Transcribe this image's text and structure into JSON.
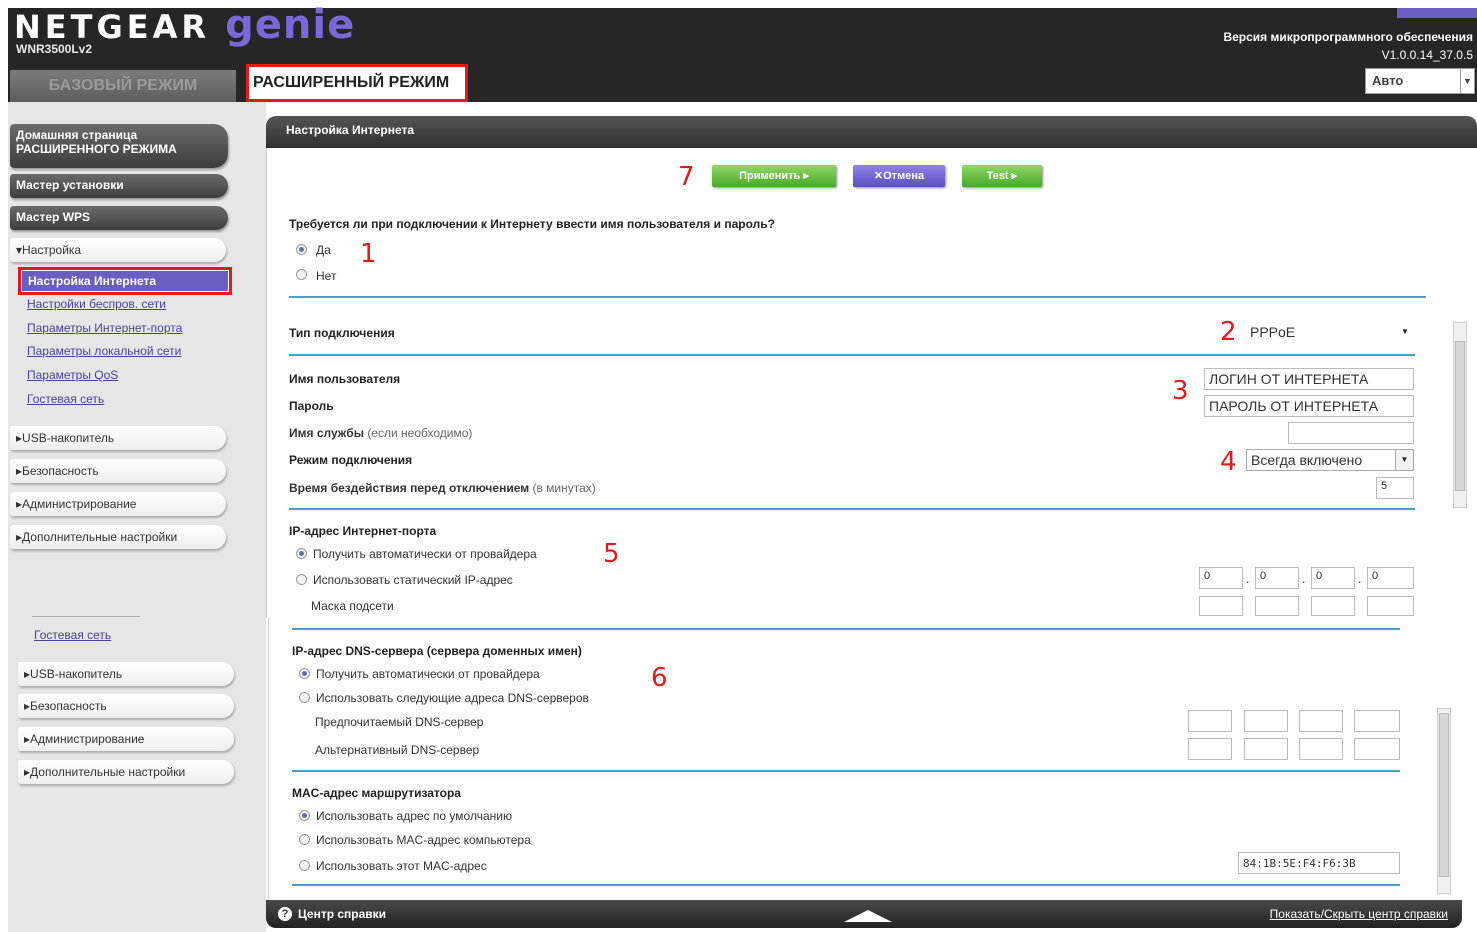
{
  "header": {
    "brand_main": "NETGEAR",
    "brand_product": "genie",
    "model": "WNR3500Lv2",
    "firmware_label": "Версия микропрограммного обеспечения",
    "firmware_version": "V1.0.0.14_37.0.5",
    "language": "Авто",
    "tabs": {
      "basic": "БАЗОВЫЙ РЕЖИМ",
      "advanced": "РАСШИРЕННЫЙ РЕЖИМ"
    }
  },
  "sidebar": {
    "home": "Домашняя страница РАСШИРЕННОГО РЕЖИМА",
    "wizard": "Мастер установки",
    "wps": "Мастер WPS",
    "setup": "▾Настройка",
    "setup_items": [
      "Настройка Интернета",
      "Настройки беспров. сети",
      "Параметры Интернет-порта",
      "Параметры локальной сети",
      "Параметры QoS",
      "Гостевая сеть"
    ],
    "sections": [
      "▸USB-накопитель",
      "▸Безопасность",
      "▸Администрирование",
      "▸Дополнительные настройки"
    ],
    "guest_network": "Гостевая сеть",
    "sections_repeat": [
      "▸USB-накопитель",
      "▸Безопасность",
      "▸Администрирование",
      "▸Дополнительные настройки"
    ]
  },
  "panel": {
    "title": "Настройка Интернета",
    "buttons": {
      "apply": "Применить ▸",
      "cancel": "✕Отмена",
      "test": "Test ▸"
    },
    "login_question": "Требуется ли при подключении к Интернету ввести имя пользователя и пароль?",
    "yes": "Да",
    "no": "Нет",
    "connection_type_label": "Тип подключения",
    "connection_type": "PPPoE",
    "username_label": "Имя пользователя",
    "username": "ЛОГИН ОТ ИНТЕРНЕТА",
    "password_label": "Пароль",
    "password": "ПАРОЛЬ ОТ ИНТЕРНЕТА",
    "service_label": "Имя службы",
    "service_hint": "(если необходимо)",
    "mode_label": "Режим подключения",
    "mode": "Всегда включено",
    "idle_label": "Время бездействия перед отключением",
    "idle_hint": "(в минутах)",
    "idle_value": "5",
    "ip_section": "IP-адрес Интернет-порта",
    "ip_auto": "Получить автоматически от провайдера",
    "ip_static": "Использовать статический IP-адрес",
    "ip_values": [
      "0",
      "0",
      "0",
      "0"
    ],
    "subnet": "Маска подсети",
    "dns_section": "IP-адрес DNS-сервера (сервера доменных имен)",
    "dns_auto": "Получить автоматически от провайдера",
    "dns_manual": "Использовать следующие адреса DNS-серверов",
    "dns_primary": "Предпочитаемый DNS-сервер",
    "dns_secondary": "Альтернативный DNS-сервер",
    "mac_section": "MAC-адрес маршрутизатора",
    "mac_default": "Использовать адрес по умолчанию",
    "mac_computer": "Использовать MAC-адрес компьютера",
    "mac_custom": "Использовать этот MAC-адрес",
    "mac_value": "84:1B:5E:F4:F6:3B",
    "annotations": [
      "1",
      "2",
      "3",
      "4",
      "5",
      "6",
      "7"
    ]
  },
  "footer": {
    "help_icon": "?",
    "help_center": "Центр справки",
    "toggle_help": "Показать/Скрыть центр справки"
  }
}
